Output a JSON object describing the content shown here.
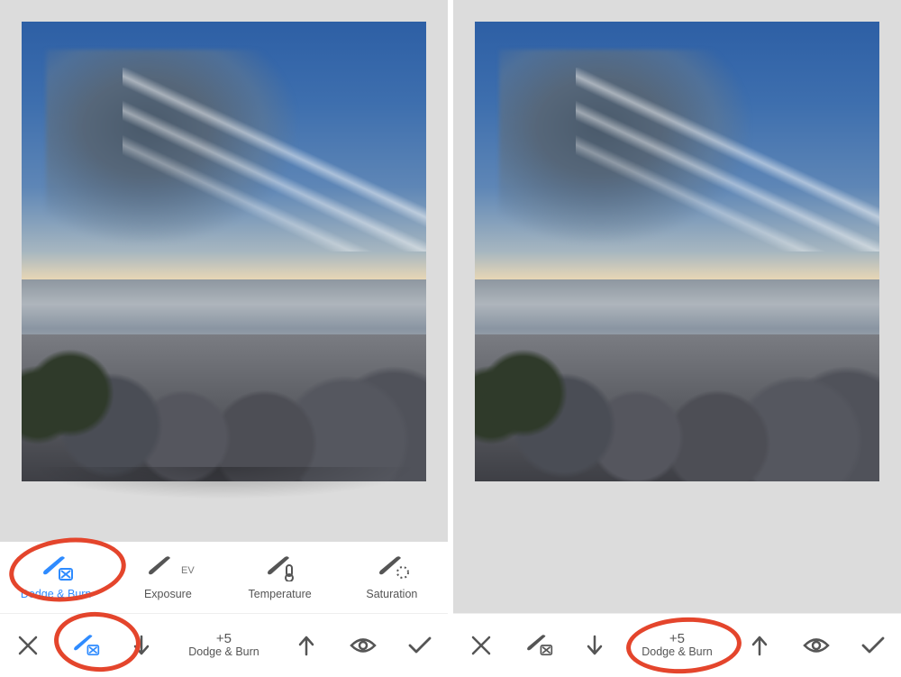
{
  "left": {
    "tools": [
      {
        "key": "dodge_burn",
        "label": "Dodge & Burn",
        "badge": "",
        "active": true
      },
      {
        "key": "exposure",
        "label": "Exposure",
        "badge": "EV",
        "active": false
      },
      {
        "key": "temperature",
        "label": "Temperature",
        "badge": "",
        "active": false
      },
      {
        "key": "saturation",
        "label": "Saturation",
        "badge": "",
        "active": false
      }
    ],
    "bottom": {
      "value": "+5",
      "label": "Dodge & Burn"
    }
  },
  "right": {
    "bottom": {
      "value": "+5",
      "label": "Dodge & Burn"
    }
  }
}
